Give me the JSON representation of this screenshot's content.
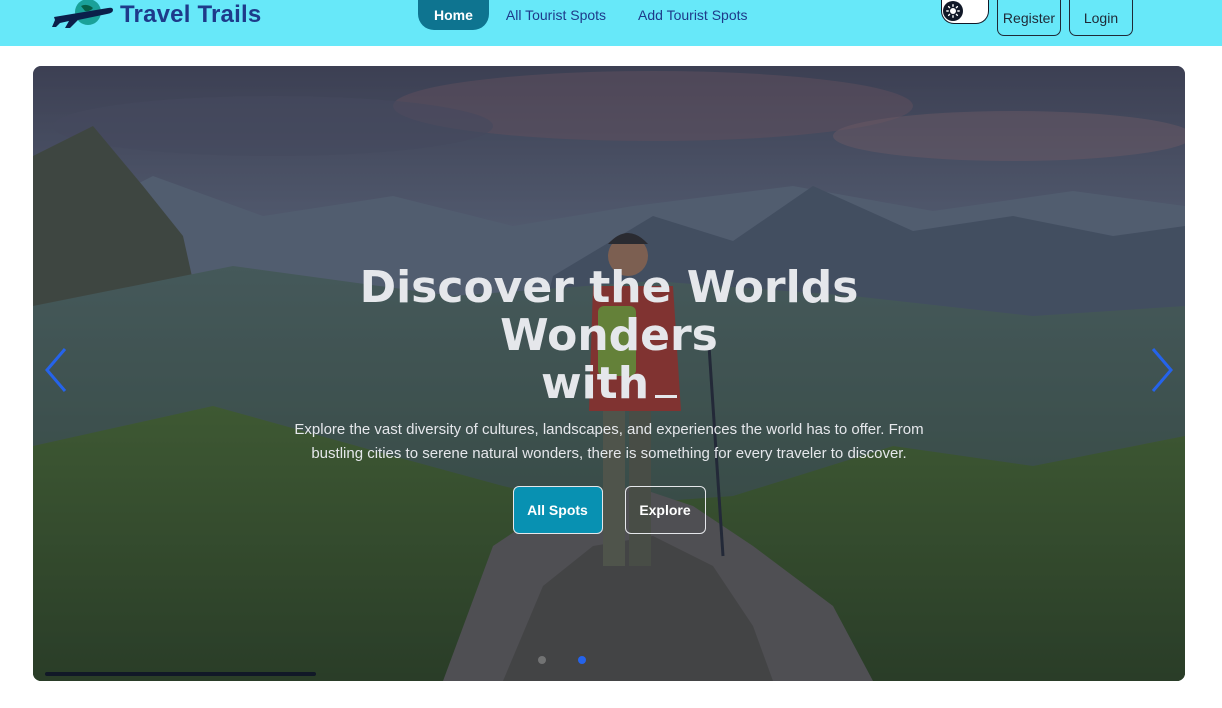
{
  "brand": {
    "name": "Travel Trails",
    "logo_icon": "airplane-globe-icon"
  },
  "nav": {
    "items": [
      {
        "label": "Home",
        "active": true
      },
      {
        "label": "All Tourist Spots",
        "active": false
      },
      {
        "label": "Add Tourist Spots",
        "active": false
      }
    ]
  },
  "theme_toggle": {
    "icon": "sun-icon",
    "state": "off"
  },
  "auth": {
    "register_label": "Register",
    "login_label": "Login"
  },
  "hero": {
    "title_line1": "Discover the Worlds Wonders",
    "title_line2": "with",
    "description": "Explore the vast diversity of cultures, landscapes, and experiences the world has to offer. From bustling cities to serene natural wonders, there is something for every traveler to discover.",
    "primary_button": "All Spots",
    "secondary_button": "Explore",
    "slide_count": 2,
    "active_slide": 2,
    "autoplay_progress": 0.24
  },
  "colors": {
    "navbar_bg": "#67e8f9",
    "brand_text": "#1e3a8a",
    "active_nav_bg": "#0e7490",
    "primary_button": "#0891b2",
    "carousel_arrow": "#2563eb"
  },
  "icons": {
    "prev": "chevron-left-icon",
    "next": "chevron-right-icon"
  }
}
